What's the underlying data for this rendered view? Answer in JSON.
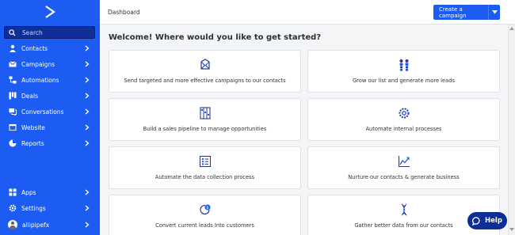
{
  "sidebar": {
    "search_placeholder": "Search",
    "items": [
      {
        "label": "Contacts",
        "icon": "person-icon"
      },
      {
        "label": "Campaigns",
        "icon": "envelope-icon"
      },
      {
        "label": "Automations",
        "icon": "flow-icon"
      },
      {
        "label": "Deals",
        "icon": "kanban-icon"
      },
      {
        "label": "Conversations",
        "icon": "chat-icon"
      },
      {
        "label": "Website",
        "icon": "browser-icon"
      },
      {
        "label": "Reports",
        "icon": "pie-chart-icon"
      }
    ],
    "bottom_items": [
      {
        "label": "Apps",
        "icon": "apps-grid-icon"
      },
      {
        "label": "Settings",
        "icon": "gear-icon"
      },
      {
        "label": "allipipefx",
        "icon": "avatar"
      }
    ]
  },
  "header": {
    "breadcrumb": "Dashboard",
    "create_button": "Create a campaign"
  },
  "main": {
    "welcome": "Welcome! Where would you like to get started?",
    "cards": [
      {
        "label": "Send targeted and more effective campaigns to our contacts",
        "icon": "envelope-send-icon"
      },
      {
        "label": "Grow our list and generate more leads",
        "icon": "people-icon"
      },
      {
        "label": "Build a sales pipeline to manage opportunities",
        "icon": "pipeline-icon"
      },
      {
        "label": "Automate internal processes",
        "icon": "gears-icon"
      },
      {
        "label": "Automate the data collection process",
        "icon": "checklist-icon"
      },
      {
        "label": "Nurture our contacts & generate business",
        "icon": "line-chart-icon"
      },
      {
        "label": "Convert current leads Into customers",
        "icon": "dollar-cycle-icon"
      },
      {
        "label": "Gather better data from our contacts",
        "icon": "dna-icon"
      }
    ]
  },
  "help": {
    "label": "Help"
  },
  "colors": {
    "brand": "#1d5cf3",
    "search_bg": "#0f2f97",
    "help_bg": "#0b2f96"
  }
}
